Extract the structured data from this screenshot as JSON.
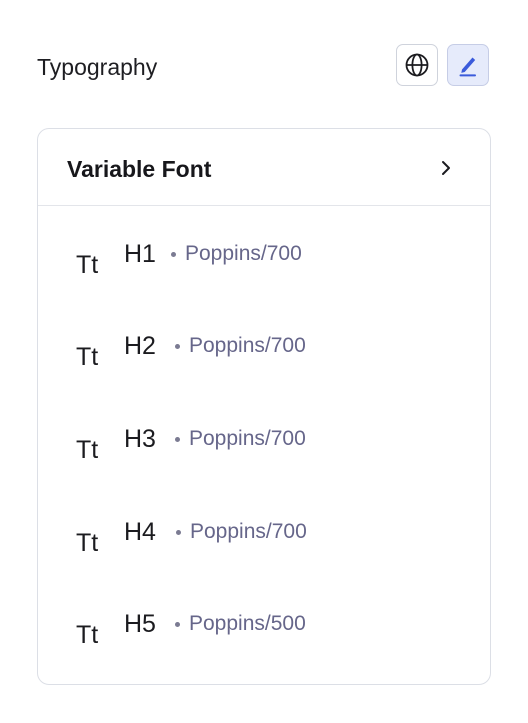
{
  "header": {
    "title": "Typography",
    "actions": [
      {
        "icon": "globe-icon"
      },
      {
        "icon": "pencil-icon",
        "active": true
      }
    ]
  },
  "card": {
    "title": "Variable Font",
    "fonts": [
      {
        "icon_text": "Tt",
        "level": "H1",
        "meta": "Poppins/700"
      },
      {
        "icon_text": "Tt",
        "level": "H2",
        "meta": "Poppins/700"
      },
      {
        "icon_text": "Tt",
        "level": "H3",
        "meta": "Poppins/700"
      },
      {
        "icon_text": "Tt",
        "level": "H4",
        "meta": "Poppins/700"
      },
      {
        "icon_text": "Tt",
        "level": "H5",
        "meta": "Poppins/500"
      }
    ]
  },
  "colors": {
    "accent": "#3b5bdb",
    "active_bg": "#e6ebfb",
    "meta_text": "#66668a",
    "border": "#dcdfe6"
  }
}
